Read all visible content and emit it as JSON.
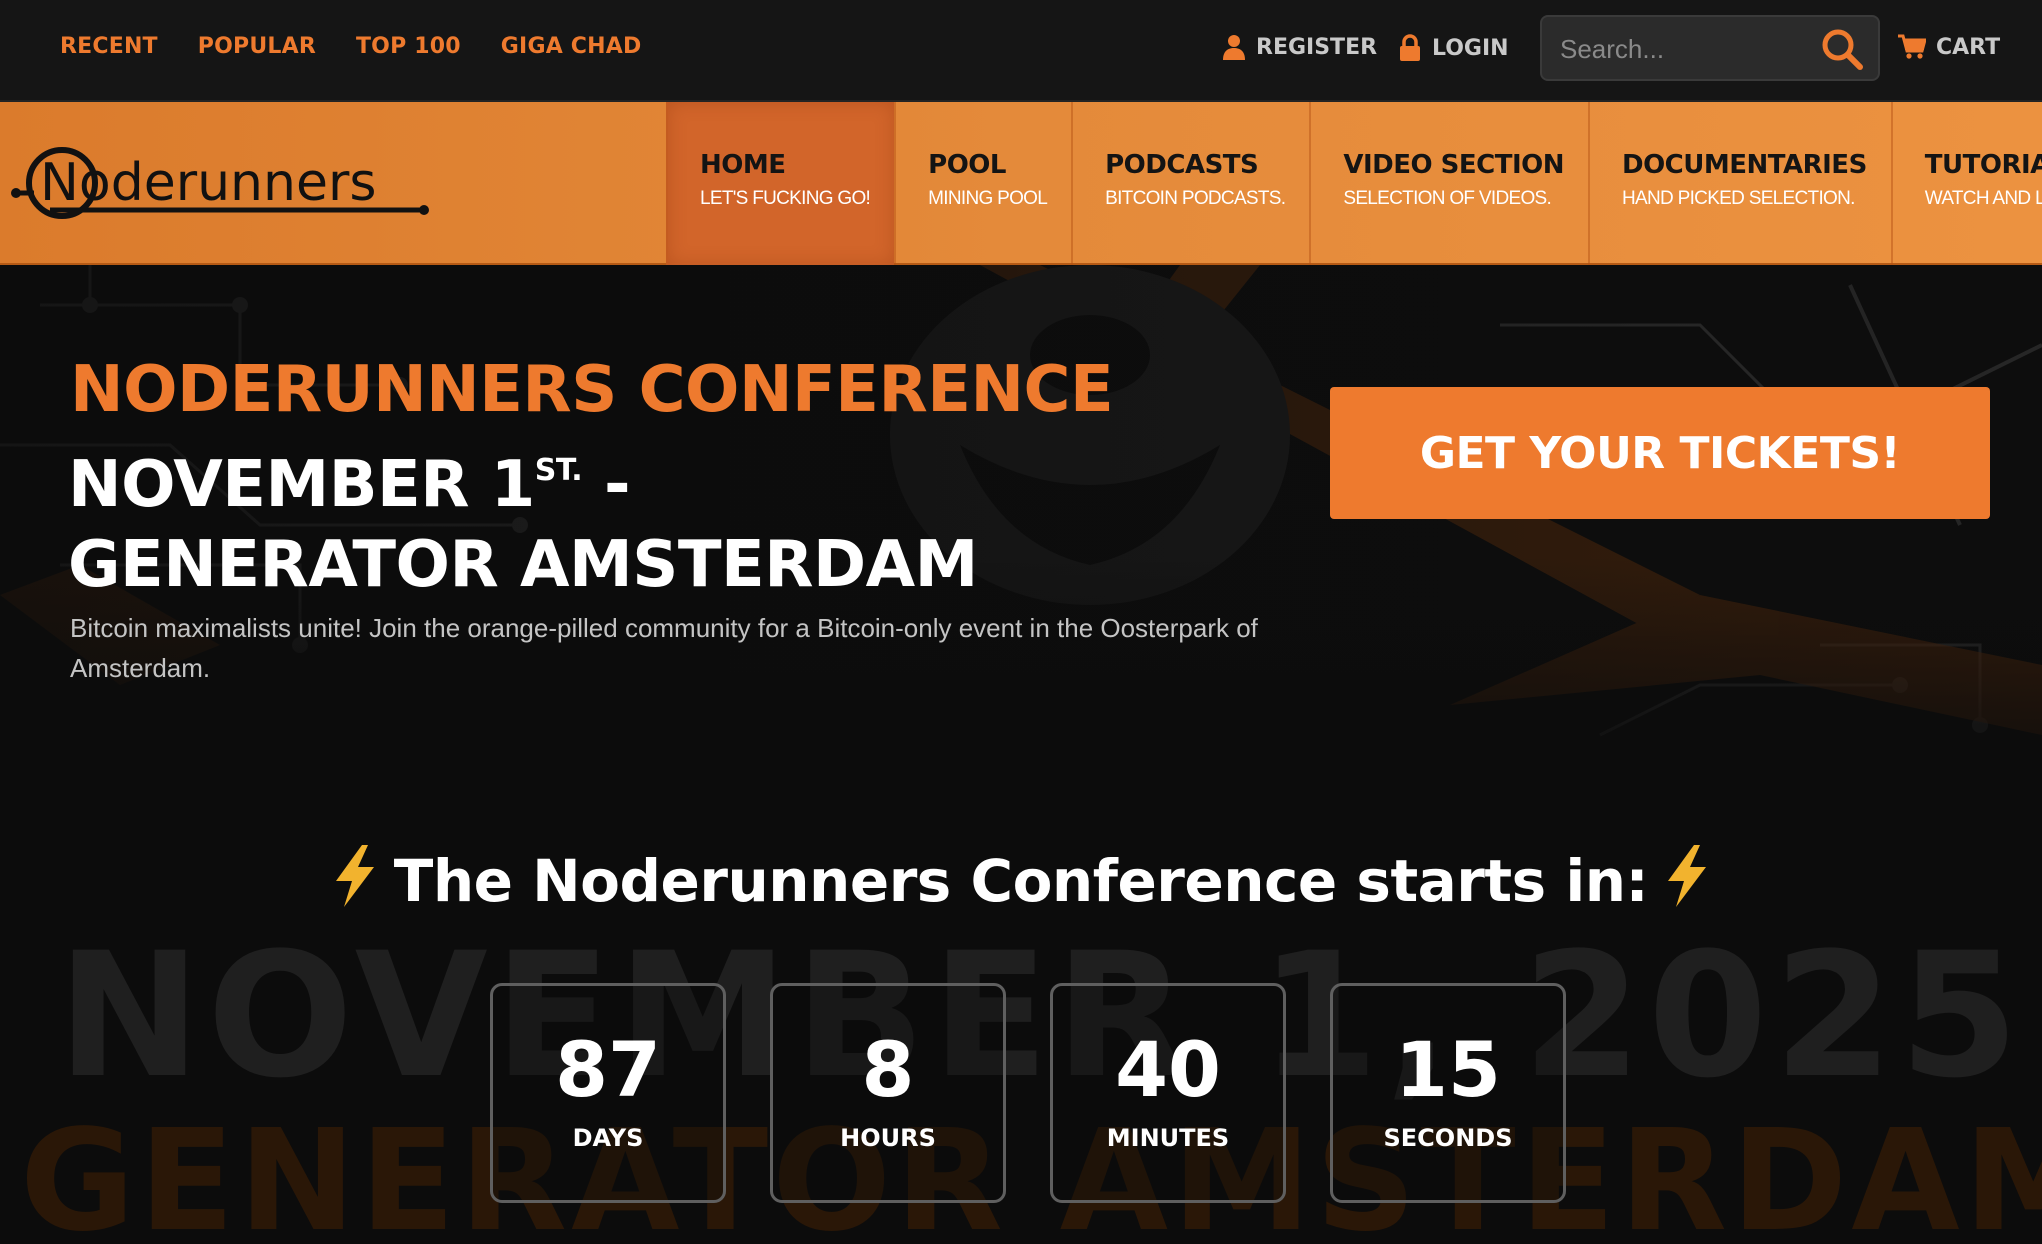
{
  "topbar": {
    "links": [
      "RECENT",
      "POPULAR",
      "TOP 100",
      "GIGA CHAD"
    ],
    "register_label": "REGISTER",
    "login_label": "LOGIN",
    "search_placeholder": "Search...",
    "cart_label": "CART"
  },
  "header": {
    "logo_text": "Noderunners",
    "nav": [
      {
        "title": "HOME",
        "subtitle": "LET'S FUCKING GO!",
        "active": true
      },
      {
        "title": "POOL",
        "subtitle": "MINING POOL",
        "active": false
      },
      {
        "title": "PODCASTS",
        "subtitle": "BITCOIN PODCASTS.",
        "active": false
      },
      {
        "title": "VIDEO SECTION",
        "subtitle": "SELECTION OF VIDEOS.",
        "active": false
      },
      {
        "title": "DOCUMENTARIES",
        "subtitle": "HAND PICKED SELECTION.",
        "active": false
      },
      {
        "title": "TUTORIALS",
        "subtitle": "WATCH AND LEARN.",
        "active": false
      }
    ]
  },
  "hero": {
    "title": "NODERUNNERS CONFERENCE",
    "subtitle_pre": "NOVEMBER 1",
    "subtitle_sup": "ST.",
    "subtitle_post": " - GENERATOR AMSTERDAM",
    "description": "Bitcoin maximalists unite! Join the orange-pilled community for a Bitcoin-only event in the Oosterpark of Amsterdam.",
    "cta_label": "GET YOUR TICKETS!"
  },
  "countdown": {
    "heading": "The Noderunners Conference starts in:",
    "watermark_line1": "NOVEMBER 1, 2025",
    "watermark_line2": "GENERATOR AMSTERDAM",
    "units": [
      {
        "value": "87",
        "label": "DAYS"
      },
      {
        "value": "8",
        "label": "HOURS"
      },
      {
        "value": "40",
        "label": "MINUTES"
      },
      {
        "value": "15",
        "label": "SECONDS"
      }
    ]
  },
  "colors": {
    "accent": "#ee7a2e",
    "header_bg": "#e48a3a",
    "topbar_bg": "#151515",
    "page_bg": "#0b0b0b"
  },
  "icons": {
    "register": "user-icon",
    "login": "lock-icon",
    "search": "search-icon",
    "cart": "cart-icon",
    "countdown": "lightning-icon"
  }
}
